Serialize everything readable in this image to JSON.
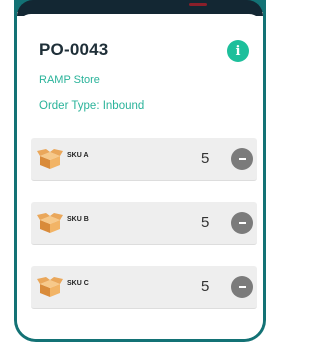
{
  "header": {
    "po_number": "PO-0043",
    "info_icon": "i",
    "store": "RAMP Store",
    "order_type": "Order Type: Inbound"
  },
  "items": [
    {
      "sku": "SKU A",
      "qty": "5",
      "icon": "box-icon",
      "action": "remove"
    },
    {
      "sku": "SKU B",
      "qty": "5",
      "icon": "box-icon",
      "action": "remove"
    },
    {
      "sku": "SKU C",
      "qty": "5",
      "icon": "box-icon",
      "action": "remove"
    }
  ],
  "colors": {
    "frame": "#137275",
    "accent": "#2ab39a",
    "info_button": "#1dbf9b",
    "remove_button": "#7b7b7b"
  }
}
